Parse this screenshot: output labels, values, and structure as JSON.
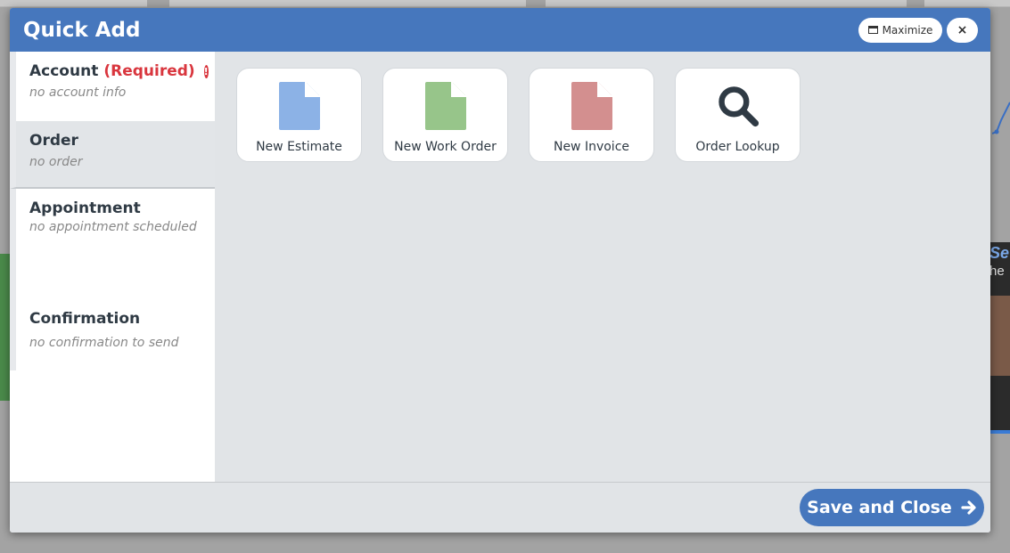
{
  "modal": {
    "title": "Quick Add",
    "maximize_label": "Maximize",
    "close_label": "×"
  },
  "sidebar": {
    "items": [
      {
        "label": "Account",
        "required": "(Required)",
        "sub": "no account info",
        "warn": "!"
      },
      {
        "label": "Order",
        "sub": "no order"
      },
      {
        "label": "Appointment",
        "sub": "no appointment scheduled"
      },
      {
        "label": "Confirmation",
        "sub": "no confirmation to send"
      }
    ]
  },
  "tiles": [
    {
      "label": "New Estimate",
      "icon": "document-icon",
      "color": "#8cb2e6"
    },
    {
      "label": "New Work Order",
      "icon": "document-icon",
      "color": "#97c58a"
    },
    {
      "label": "New Invoice",
      "icon": "document-icon",
      "color": "#d38f8f"
    },
    {
      "label": "Order Lookup",
      "icon": "search-icon",
      "color": "#2f3a44"
    }
  ],
  "footer": {
    "save_label": "Save and Close"
  },
  "colors": {
    "header": "#4677bd",
    "required": "#d9363e"
  },
  "background": {
    "video_line1": "Se",
    "video_line2": "he"
  }
}
